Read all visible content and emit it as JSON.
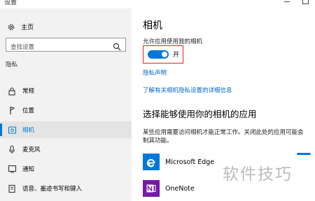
{
  "window": {
    "title": "设置"
  },
  "sidebar": {
    "home_label": "主页",
    "search_placeholder": "查找设置",
    "section_title": "隐私",
    "items": [
      {
        "label": "常规",
        "icon": "lock-icon"
      },
      {
        "label": "位置",
        "icon": "location-pin-icon"
      },
      {
        "label": "相机",
        "icon": "camera-icon",
        "selected": true
      },
      {
        "label": "麦克风",
        "icon": "microphone-icon"
      },
      {
        "label": "通知",
        "icon": "notification-icon"
      },
      {
        "label": "语音、墨迹书写和键入",
        "icon": "notebook-icon"
      }
    ]
  },
  "main": {
    "title": "相机",
    "allow_label": "允许应用使用我的相机",
    "toggle_state": "开",
    "toggle_on": true,
    "privacy_link": "隐私声明",
    "details_link": "了解有关相机隐私设置的详细信息",
    "apps_heading": "选择能够使用你的相机的应用",
    "apps_desc_line1": "某些应用需要访问相机才能正常工作。关闭此处的应用可能会",
    "apps_desc_line2": "制其功能。",
    "apps": [
      {
        "name": "Microsoft Edge",
        "icon": "edge-icon",
        "color": "#0078d7"
      },
      {
        "name": "OneNote",
        "icon": "onenote-icon",
        "color": "#7719aa"
      }
    ]
  },
  "watermark": "软件技巧",
  "colors": {
    "accent": "#0078d7",
    "highlight_frame": "#e0211c",
    "sidebar_bg": "#f2f2f2"
  }
}
